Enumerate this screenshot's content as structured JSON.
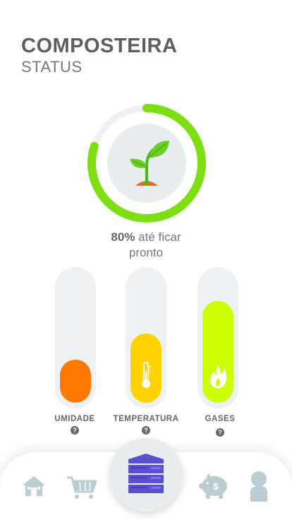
{
  "header": {
    "title": "COMPOSTEIRA",
    "subtitle": "STATUS"
  },
  "progress": {
    "value": 0.8,
    "percent_label": "80%",
    "text_line1": "até ficar",
    "text_line2": "pronto",
    "color": "#7ddf11"
  },
  "gauges": [
    {
      "label": "UMIDADE",
      "level": 0.33,
      "color": "#ff7a00",
      "icon": "none"
    },
    {
      "label": "TEMPERATURA",
      "level": 0.53,
      "color": "#ffd200",
      "icon": "thermometer-icon"
    },
    {
      "label": "GASES",
      "level": 0.78,
      "color": "#ccff00",
      "icon": "flame-icon"
    }
  ],
  "help_glyph": "?",
  "nav": {
    "items": [
      "home-icon",
      "cart-icon",
      "compost-bin-icon",
      "piggy-bank-icon",
      "profile-icon"
    ],
    "icon_color": "#b9cdd2",
    "active_color": "#5a4fcf"
  }
}
